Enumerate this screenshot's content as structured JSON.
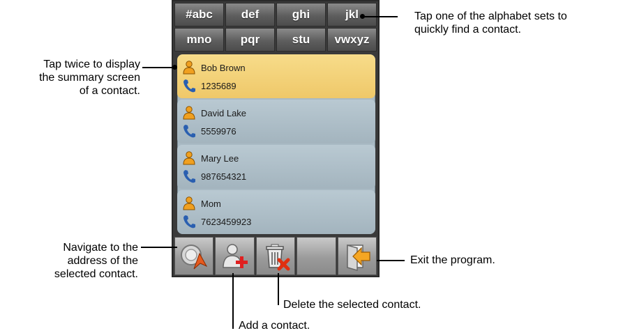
{
  "alphabet_sets": [
    "#abc",
    "def",
    "ghi",
    "jkl",
    "mno",
    "pqr",
    "stu",
    "vwxyz"
  ],
  "contacts": [
    {
      "name": "Bob Brown",
      "phone": "1235689",
      "selected": true
    },
    {
      "name": "David Lake",
      "phone": "5559976",
      "selected": false
    },
    {
      "name": "Mary Lee",
      "phone": "987654321",
      "selected": false
    },
    {
      "name": "Mom",
      "phone": "7623459923",
      "selected": false
    }
  ],
  "toolbar": {
    "buttons": [
      "navigate-icon",
      "add-contact-icon",
      "delete-icon",
      "empty",
      "exit-icon"
    ]
  },
  "callouts": {
    "alphabet": [
      "Tap one of the alphabet sets to",
      "quickly find a contact."
    ],
    "tap_twice": [
      "Tap twice to display",
      "the summary screen",
      "of a contact."
    ],
    "navigate": [
      "Navigate to the",
      "address of the",
      "selected contact."
    ],
    "exit": "Exit the program.",
    "delete": "Delete the selected contact.",
    "add": "Add a contact."
  },
  "colors": {
    "selected_row": "#efc869",
    "list_bg": "#a9bac4",
    "person_icon": "#f0a020",
    "phone_icon": "#2a5fb0"
  }
}
